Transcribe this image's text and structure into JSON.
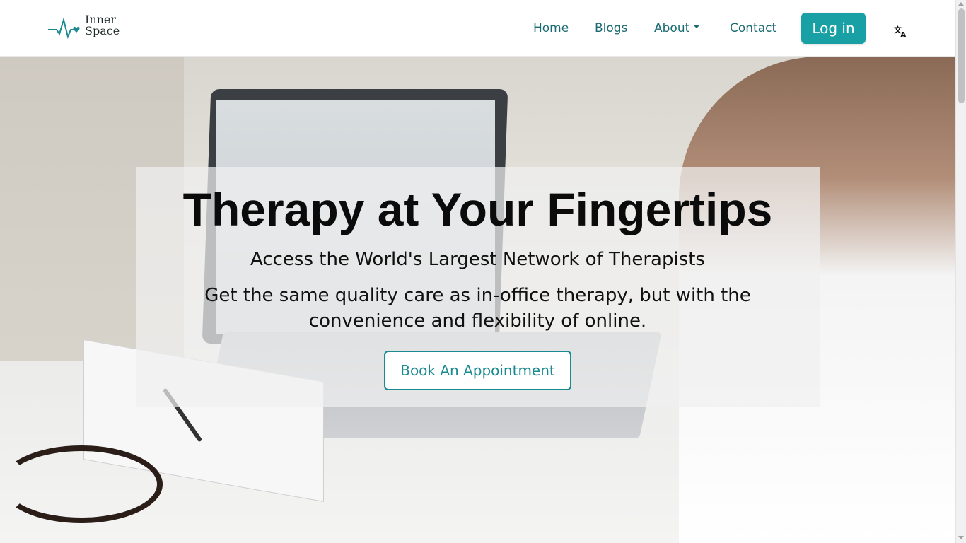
{
  "header": {
    "logo": {
      "line1": "Inner",
      "line2": "Space",
      "icon": "heartbeat-heart-icon",
      "accent": "#1b8a90"
    },
    "nav": {
      "home": "Home",
      "blogs": "Blogs",
      "about": "About",
      "contact": "Contact"
    },
    "login_label": "Log in",
    "language_icon": "translate-icon"
  },
  "hero": {
    "title": "Therapy at Your Fingertips",
    "subtitle": "Access the World's Largest Network of Therapists",
    "description": "Get the same quality care as in-office therapy, but with the convenience and flexibility of online.",
    "cta_label": "Book An Appointment",
    "image": "therapist-video-call-photo"
  },
  "colors": {
    "brand": "#18a0a5",
    "nav_text": "#1b6a72",
    "title_text": "#0b0b0b"
  }
}
